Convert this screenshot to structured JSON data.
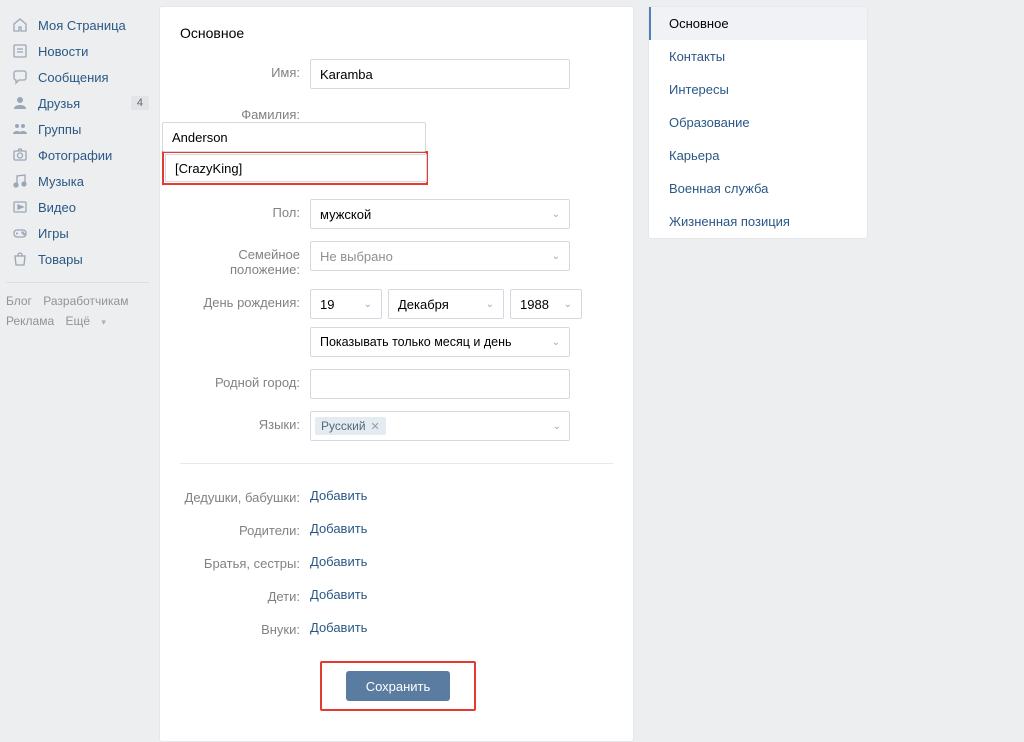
{
  "nav": {
    "items": [
      {
        "label": "Моя Страница",
        "icon": "home"
      },
      {
        "label": "Новости",
        "icon": "news"
      },
      {
        "label": "Сообщения",
        "icon": "messages"
      },
      {
        "label": "Друзья",
        "icon": "friends",
        "badge": "4"
      },
      {
        "label": "Группы",
        "icon": "groups"
      },
      {
        "label": "Фотографии",
        "icon": "photos"
      },
      {
        "label": "Музыка",
        "icon": "music"
      },
      {
        "label": "Видео",
        "icon": "video"
      },
      {
        "label": "Игры",
        "icon": "games"
      },
      {
        "label": "Товары",
        "icon": "market"
      }
    ],
    "footer": [
      "Блог",
      "Разработчикам",
      "Реклама",
      "Ещё"
    ]
  },
  "main": {
    "title": "Основное",
    "labels": {
      "name": "Имя:",
      "surname": "Фамилия:",
      "sex": "Пол:",
      "relation": "Семейное положение:",
      "bday": "День рождения:",
      "hometown": "Родной город:",
      "langs": "Языки:",
      "grandparents": "Дедушки, бабушки:",
      "parents": "Родители:",
      "siblings": "Братья, сестры:",
      "children": "Дети:",
      "grandchildren": "Внуки:"
    },
    "values": {
      "name": "Karamba",
      "surname": "Anderson",
      "nickname": "[CrazyKing]",
      "sex": "мужской",
      "relation_placeholder": "Не выбрано",
      "bday_day": "19",
      "bday_month": "Декабря",
      "bday_year": "1988",
      "bday_show": "Показывать только месяц и день",
      "hometown": "",
      "lang_chip": "Русский"
    },
    "add_link": "Добавить",
    "save": "Сохранить"
  },
  "tabs": [
    "Основное",
    "Контакты",
    "Интересы",
    "Образование",
    "Карьера",
    "Военная служба",
    "Жизненная позиция"
  ]
}
